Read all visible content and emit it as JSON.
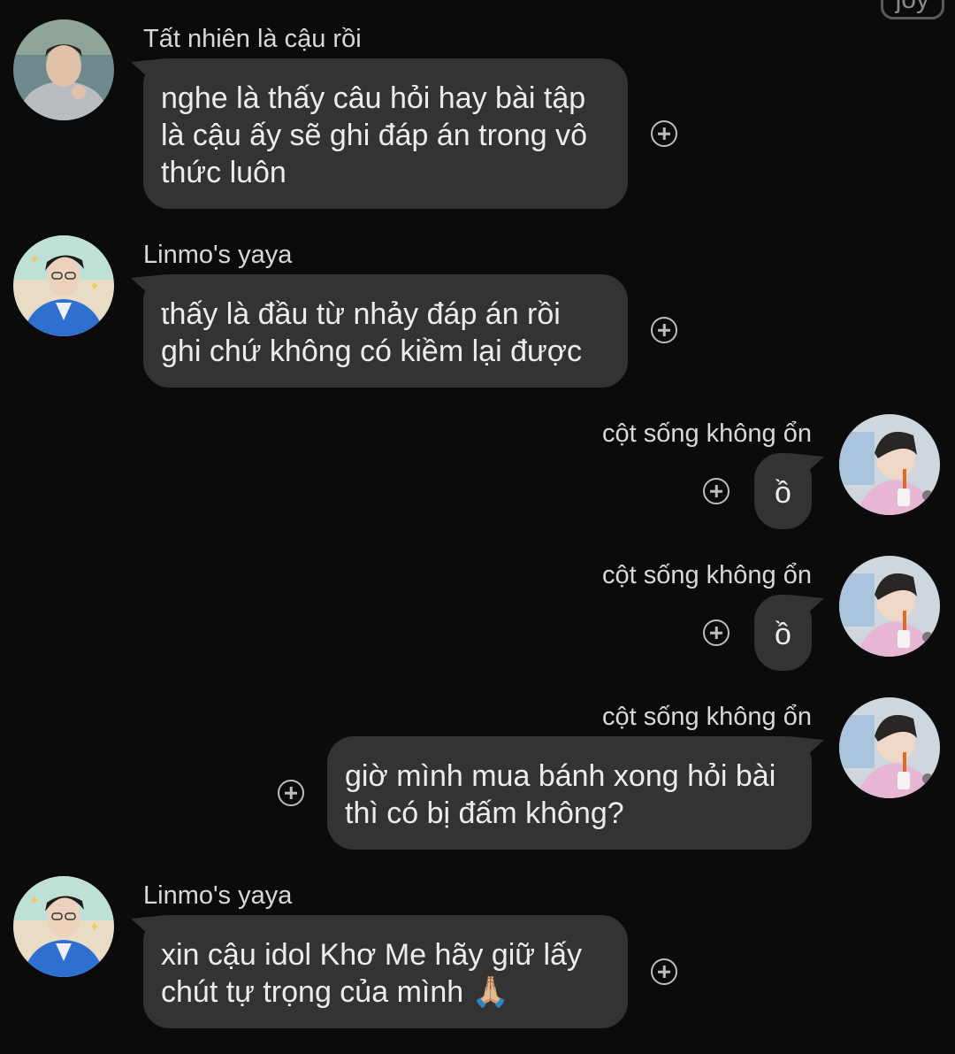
{
  "top_partial_text": "joy",
  "messages": [
    {
      "sender": "Tất nhiên là cậu rồi",
      "lines": [
        "nghe là thấy câu hỏi hay bài tập",
        "là cậu ấy sẽ ghi đáp án trong vô",
        "thức luôn"
      ],
      "side": "left"
    },
    {
      "sender": "Linmo's yaya",
      "lines": [
        "thấy là đầu từ nhảy đáp án rồi",
        "ghi chứ không có kiềm lại được"
      ],
      "side": "left"
    },
    {
      "sender": "cột sống không ổn",
      "lines": [
        "ồ"
      ],
      "side": "right"
    },
    {
      "sender": "cột sống không ổn",
      "lines": [
        "ồ"
      ],
      "side": "right"
    },
    {
      "sender": "cột sống không ổn",
      "lines": [
        "giờ mình mua bánh xong hỏi bài",
        "thì có bị đấm không?"
      ],
      "side": "right"
    },
    {
      "sender": "Linmo's yaya",
      "lines": [
        "xin cậu idol Khơ Me hãy giữ lấy",
        "chút tự trọng của mình 🙏🏼"
      ],
      "side": "left"
    }
  ],
  "icons": {
    "reaction": "add-reaction-icon",
    "avatar_tat_nhien": "avatar-grey-hoodie",
    "avatar_linmo": "avatar-blue-jacket",
    "avatar_cot_song": "avatar-pink-shirt-straw"
  },
  "colors": {
    "background": "#0b0b0b",
    "bubble": "#333333",
    "text": "#ececec",
    "sender_text": "#d8d8d8"
  }
}
